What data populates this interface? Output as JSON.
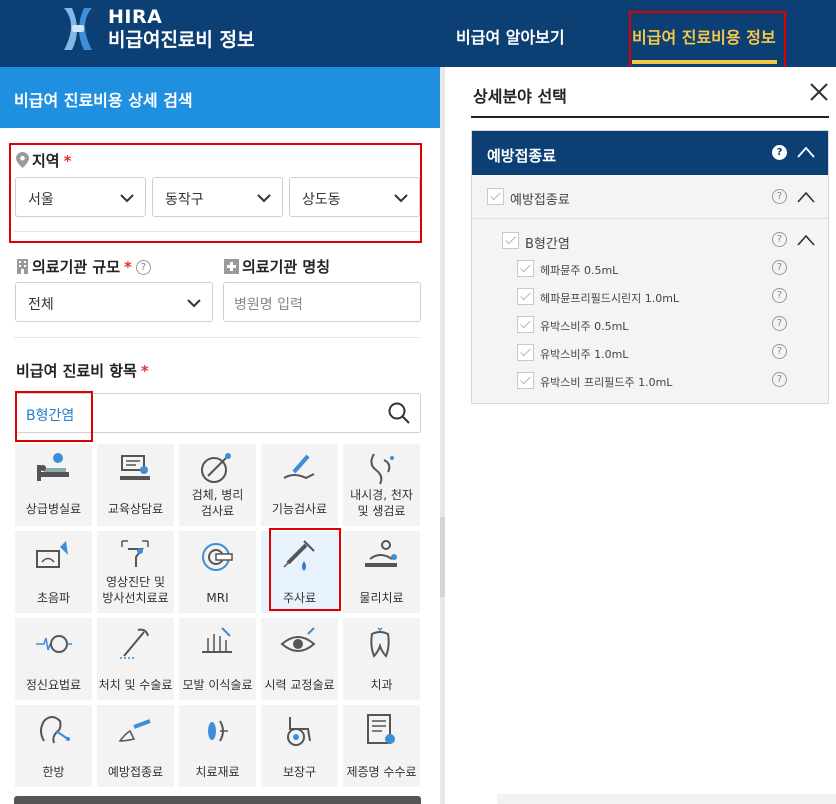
{
  "header": {
    "brand_line1": "HIRA",
    "brand_line2": "비급여진료비 정보",
    "nav": [
      "비급여 알아보기",
      "비급여 진료비용 정보"
    ],
    "colors": {
      "header_bg": "#0c3f73",
      "active_nav": "#f6c84a"
    }
  },
  "left": {
    "title": "비급여 진료비용 상세 검색",
    "region": {
      "label": "지역",
      "required_mark": "*",
      "selects": [
        "서울",
        "동작구",
        "상도동"
      ]
    },
    "scale": {
      "label": "의료기관 규모",
      "required_mark": "*",
      "help": "?",
      "value": "전체"
    },
    "name": {
      "label": "의료기관 명칭",
      "placeholder": "병원명 입력"
    },
    "item": {
      "label": "비급여 진료비 항목",
      "required_mark": "*",
      "search_value": "B형간염"
    },
    "categories": [
      {
        "label": "상급병실료",
        "icon": "hospital-bed-icon"
      },
      {
        "label": "교육상담료",
        "icon": "consultation-icon"
      },
      {
        "label1": "검체, 병리",
        "label2": "검사료",
        "icon": "specimen-icon"
      },
      {
        "label": "기능검사료",
        "icon": "function-test-icon"
      },
      {
        "label1": "내시경, 천자",
        "label2": "및 생검료",
        "icon": "endoscope-icon"
      },
      {
        "label": "초음파",
        "icon": "ultrasound-icon"
      },
      {
        "label1": "영상진단 및",
        "label2": "방사선치료료",
        "icon": "radiology-icon"
      },
      {
        "label": "MRI",
        "icon": "mri-icon"
      },
      {
        "label": "주사료",
        "icon": "syringe-icon"
      },
      {
        "label": "물리치료",
        "icon": "physical-therapy-icon"
      },
      {
        "label": "정신요법료",
        "icon": "brain-wave-icon"
      },
      {
        "label": "처치 및 수술료",
        "icon": "surgery-icon"
      },
      {
        "label": "모발 이식술료",
        "icon": "hair-transplant-icon"
      },
      {
        "label": "시력 교정술료",
        "icon": "eye-icon"
      },
      {
        "label": "치과",
        "icon": "tooth-icon"
      },
      {
        "label": "한방",
        "icon": "acupuncture-icon"
      },
      {
        "label": "예방접종료",
        "icon": "vaccination-icon"
      },
      {
        "label": "치료재료",
        "icon": "treatment-material-icon"
      },
      {
        "label": "보장구",
        "icon": "wheelchair-icon"
      },
      {
        "label": "제증명 수수료",
        "icon": "certificate-icon"
      }
    ]
  },
  "right": {
    "title": "상세분야 선택",
    "tree_head": "예방접종료",
    "level1": "예방접종료",
    "level2": "B형간염",
    "items": [
      "헤파뮨주 0.5mL",
      "헤파뮨프리필드시린지 1.0mL",
      "유박스비주 0.5mL",
      "유박스비주 1.0mL",
      "유박스비 프리필드주 1.0mL"
    ],
    "help": "?"
  }
}
